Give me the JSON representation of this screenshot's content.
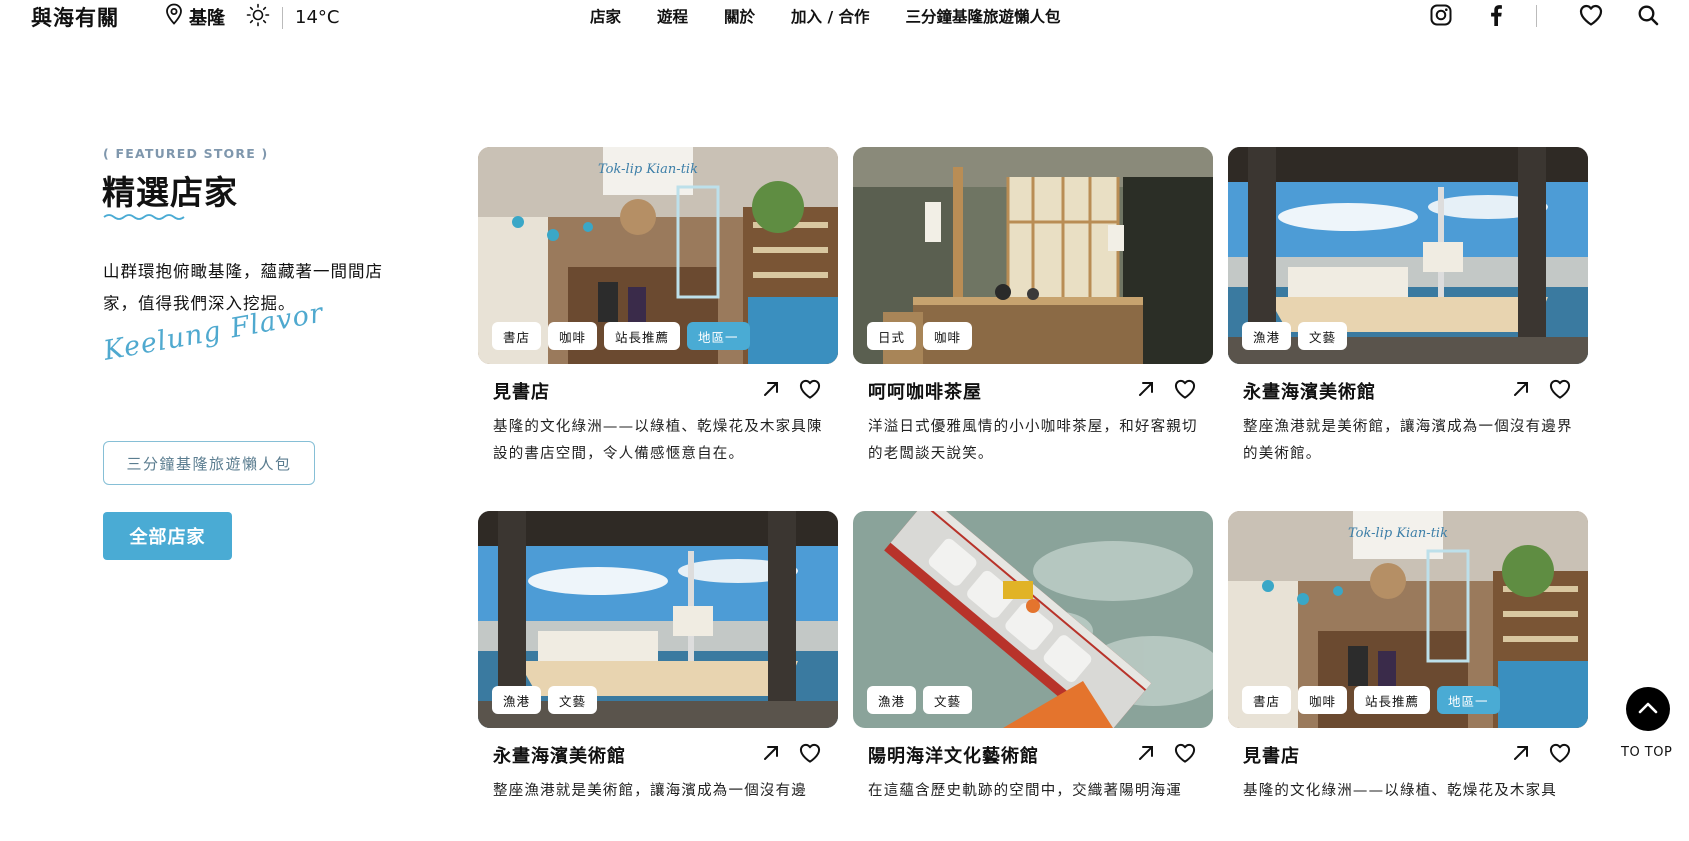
{
  "header": {
    "logo": "與海有關",
    "location": "基隆",
    "temperature": "14°C",
    "nav": [
      "店家",
      "遊程",
      "關於",
      "加入 / 合作",
      "三分鐘基隆旅遊懶人包"
    ]
  },
  "featured": {
    "kicker": "( FEATURED STORE )",
    "title": "精選店家",
    "description": "山群環抱俯瞰基隆，蘊藏著一間間店家，值得我們深入挖掘。",
    "script": "Keelung Flavor",
    "guide_button": "三分鐘基隆旅遊懶人包",
    "all_button": "全部店家"
  },
  "cards": [
    {
      "name": "見書店",
      "tags": [
        "書店",
        "咖啡",
        "站長推薦",
        "地區一"
      ],
      "desc": "基隆的文化綠洲——以綠植、乾燥花及木家具陳設的書店空間，令人備感愜意自在。"
    },
    {
      "name": "呵呵咖啡茶屋",
      "tags": [
        "日式",
        "咖啡"
      ],
      "desc": "洋溢日式優雅風情的小小咖啡茶屋，和好客親切的老闆談天說笑。"
    },
    {
      "name": "永晝海濱美術館",
      "tags": [
        "漁港",
        "文藝"
      ],
      "desc": "整座漁港就是美術館，讓海濱成為一個沒有邊界的美術館。"
    },
    {
      "name": "永晝海濱美術館",
      "tags": [
        "漁港",
        "文藝"
      ],
      "desc": "整座漁港就是美術館，讓海濱成為一個沒有邊"
    },
    {
      "name": "陽明海洋文化藝術館",
      "tags": [
        "漁港",
        "文藝"
      ],
      "desc": "在這蘊含歷史軌跡的空間中，交織著陽明海運"
    },
    {
      "name": "見書店",
      "tags": [
        "書店",
        "咖啡",
        "站長推薦",
        "地區一"
      ],
      "desc": "基隆的文化綠洲——以綠植、乾燥花及木家具"
    }
  ],
  "to_top": "TO TOP"
}
